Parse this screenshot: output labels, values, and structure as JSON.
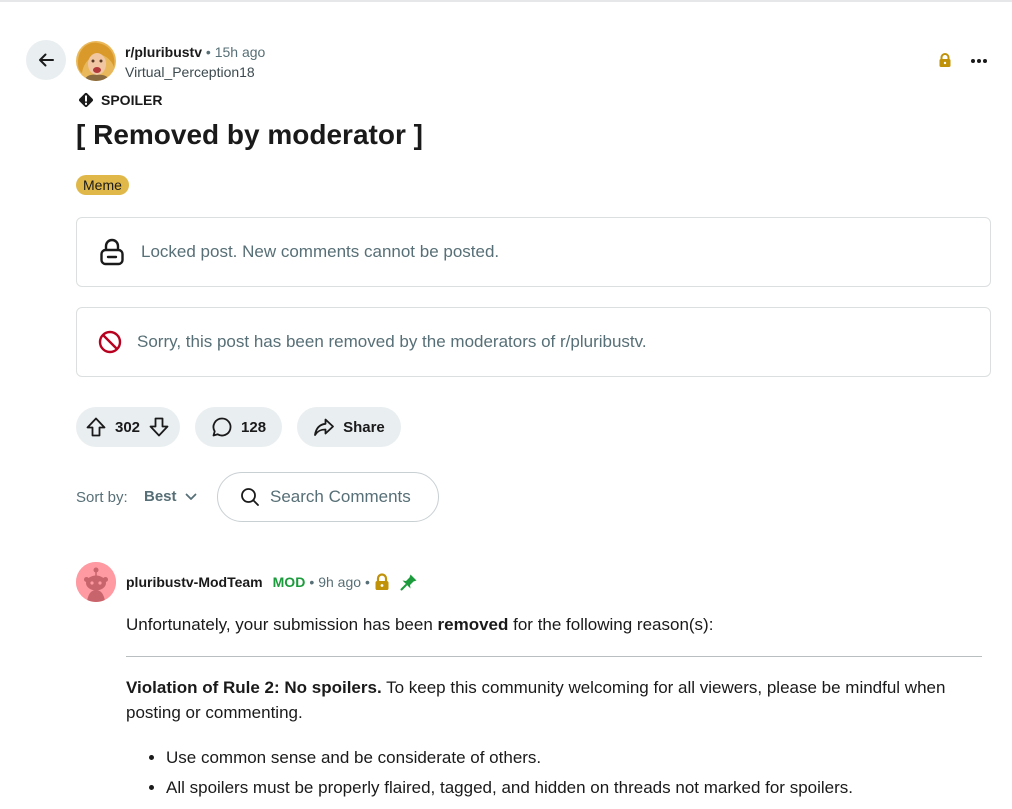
{
  "post": {
    "subreddit": "r/pluribustv",
    "separator": "•",
    "time": "15h ago",
    "author": "Virtual_Perception18",
    "spoiler_label": "SPOILER",
    "title": "[ Removed by moderator ]",
    "flair": "Meme",
    "flair_color": "#e0b849"
  },
  "notices": {
    "locked": "Locked post. New comments cannot be posted.",
    "removed": "Sorry, this post has been removed by the moderators of r/pluribustv."
  },
  "actions": {
    "votes": "302",
    "comments": "128",
    "share": "Share"
  },
  "sort": {
    "label": "Sort by:",
    "value": "Best"
  },
  "search": {
    "placeholder": "Search Comments"
  },
  "comment": {
    "username": "pluribustv-ModTeam",
    "badge": "MOD",
    "separator": "•",
    "time": "9h ago",
    "intro_before": "Unfortunately, your submission has been ",
    "intro_bold": "removed",
    "intro_after": " for the following reason(s):",
    "rule_bold": "Violation of Rule 2: No spoilers.",
    "rule_text": " To keep this community welcoming for all viewers, please be mindful when posting or commenting.",
    "bullets": [
      "Use common sense and be considerate of others.",
      "All spoilers must be properly flaired, tagged, and hidden on threads not marked for spoilers."
    ]
  },
  "colors": {
    "mod_green": "#1b9b3b",
    "lock_gold": "#c0920a",
    "removed_red": "#b8001f",
    "pill_bg": "#e9eef0"
  }
}
